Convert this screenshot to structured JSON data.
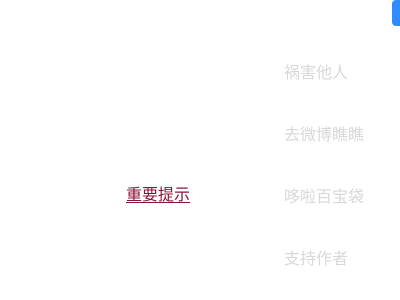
{
  "main": {
    "important_link": "重要提示"
  },
  "menu": {
    "items": [
      {
        "label": "祸害他人"
      },
      {
        "label": "去微博瞧瞧"
      },
      {
        "label": "哆啦百宝袋"
      },
      {
        "label": "支持作者"
      }
    ]
  },
  "colors": {
    "link": "#8b1538",
    "menu_text": "#d8d8d8",
    "accent_chip": "#2f8cff",
    "background": "#ffffff"
  }
}
